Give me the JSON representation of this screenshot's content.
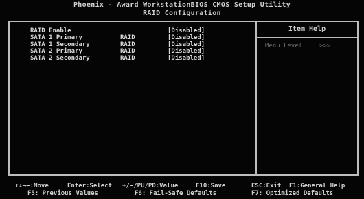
{
  "header": {
    "title": "Phoenix - Award WorkstationBIOS CMOS Setup Utility",
    "subtitle": "RAID Configuration"
  },
  "settings": [
    {
      "label": "RAID Enable",
      "mode": "",
      "value": "[Disabled]"
    },
    {
      "label": "SATA 1 Primary",
      "mode": "RAID",
      "value": "[Disabled]"
    },
    {
      "label": "SATA 1 Secondary",
      "mode": "RAID",
      "value": "[Disabled]"
    },
    {
      "label": "SATA 2 Primary",
      "mode": "RAID",
      "value": "[Disabled]"
    },
    {
      "label": "SATA 2 Secondary",
      "mode": "RAID",
      "value": "[Disabled]"
    }
  ],
  "help_panel": {
    "title": "Item Help",
    "menu_level": "Menu Level",
    "menu_level_marker": ">>>"
  },
  "footer": {
    "line1": {
      "move": "↑↓→←:Move",
      "select": "Enter:Select",
      "value": "+/-/PU/PD:Value",
      "save": "F10:Save",
      "exit": "ESC:Exit",
      "help": "F1:General Help"
    },
    "line2": {
      "previous": "F5: Previous Values",
      "failsafe": "F6: Fail-Safe Defaults",
      "optimized": "F7: Optimized Defaults"
    }
  }
}
